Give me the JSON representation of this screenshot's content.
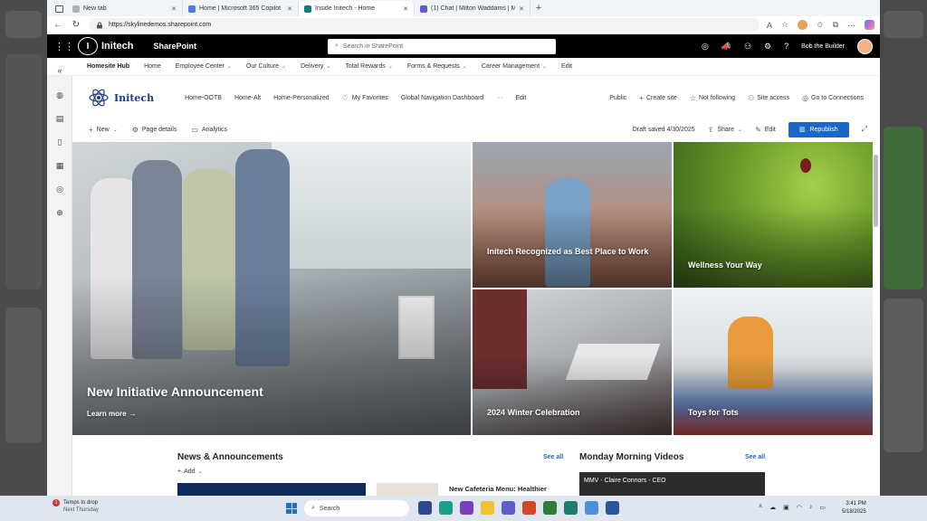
{
  "browser": {
    "tabs": [
      {
        "label": "New tab",
        "active": false
      },
      {
        "label": "Home | Microsoft 365 Copilot",
        "active": false
      },
      {
        "label": "Inside Initech - Home",
        "active": true
      },
      {
        "label": "(1) Chat | Milton Waddams | Micr",
        "active": false
      }
    ],
    "url": "https://skylinedemos.sharepoint.com"
  },
  "suitebar": {
    "brand": "Initech",
    "app": "SharePoint",
    "search_placeholder": "Search in SharePoint",
    "user_name": "Bob the Builder"
  },
  "hubnav": {
    "title": "Homesite Hub",
    "items": [
      {
        "label": "Home",
        "dropdown": false
      },
      {
        "label": "Employee Center",
        "dropdown": true
      },
      {
        "label": "Our Culture",
        "dropdown": true
      },
      {
        "label": "Delivery",
        "dropdown": true
      },
      {
        "label": "Total Rewards",
        "dropdown": true
      },
      {
        "label": "Forms & Requests",
        "dropdown": true
      },
      {
        "label": "Career Management",
        "dropdown": true
      },
      {
        "label": "Edit",
        "dropdown": false
      }
    ]
  },
  "site": {
    "name": "Initech",
    "nav": [
      "Home-OOTB",
      "Home-Alt",
      "Home-Personalized",
      "My Favorites",
      "Global Navigation Dashboard",
      "···",
      "Edit"
    ],
    "privacy": "Public",
    "actions": [
      "Create site",
      "Not following",
      "Site access",
      "Go to Connections"
    ]
  },
  "commandbar": {
    "new": "New",
    "page_details": "Page details",
    "analytics": "Analytics",
    "draft": "Draft saved 4/30/2025",
    "share": "Share",
    "edit": "Edit",
    "republish": "Republish"
  },
  "hero": {
    "main": {
      "title": "New Initiative Announcement",
      "link": "Learn more"
    },
    "tiles": [
      {
        "title": "Initech Recognized as Best Place to Work"
      },
      {
        "title": "Wellness Your Way"
      },
      {
        "title": "2024 Winter Celebration"
      },
      {
        "title": "Toys for Tots"
      }
    ]
  },
  "news": {
    "title": "News & Announcements",
    "see_all": "See all",
    "add": "Add",
    "headline": "New Cafeteria Menu: Healthier"
  },
  "videos": {
    "title": "Monday Morning Videos",
    "see_all": "See all",
    "first": "MMV - Claire Connors - CEO"
  },
  "taskbar": {
    "weather_title": "Temps to drop",
    "weather_sub": "Next Thursday",
    "weather_badge": "1",
    "search": "Search",
    "time": "3:41 PM",
    "date": "5/18/2025"
  },
  "colors": {
    "suite_bar": "#000000",
    "brand_blue": "#1b67c9",
    "site_logo": "#1a3f87"
  }
}
